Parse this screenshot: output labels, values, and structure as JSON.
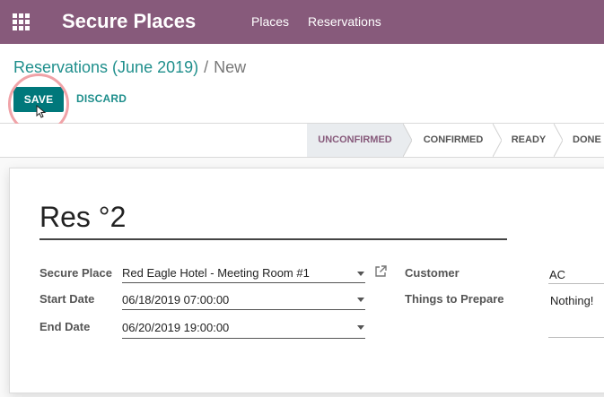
{
  "navbar": {
    "app_title": "Secure Places",
    "menu": [
      "Places",
      "Reservations"
    ]
  },
  "breadcrumb": {
    "parent": "Reservations (June 2019)",
    "separator": "/",
    "current": "New"
  },
  "buttons": {
    "save": "SAVE",
    "discard": "DISCARD"
  },
  "statusbar": {
    "stages": [
      "UNCONFIRMED",
      "CONFIRMED",
      "READY",
      "DONE"
    ],
    "active": "UNCONFIRMED"
  },
  "form": {
    "title": "Res °2",
    "fields": {
      "secure_place": {
        "label": "Secure Place",
        "value": "Red Eagle Hotel - Meeting Room #1"
      },
      "start_date": {
        "label": "Start Date",
        "value": "06/18/2019 07:00:00"
      },
      "end_date": {
        "label": "End Date",
        "value": "06/20/2019 19:00:00"
      },
      "customer": {
        "label": "Customer",
        "value": "AC"
      },
      "things_to_prepare": {
        "label": "Things to Prepare",
        "value": "Nothing!"
      }
    }
  },
  "colors": {
    "navbar": "#875a7b",
    "primary_button": "#00787b",
    "link": "#1f8f8c",
    "highlight_ring": "#f0a3a8"
  },
  "icons": [
    "apps-grid-icon",
    "external-link-icon",
    "dropdown-caret-icon",
    "mouse-cursor-icon"
  ]
}
